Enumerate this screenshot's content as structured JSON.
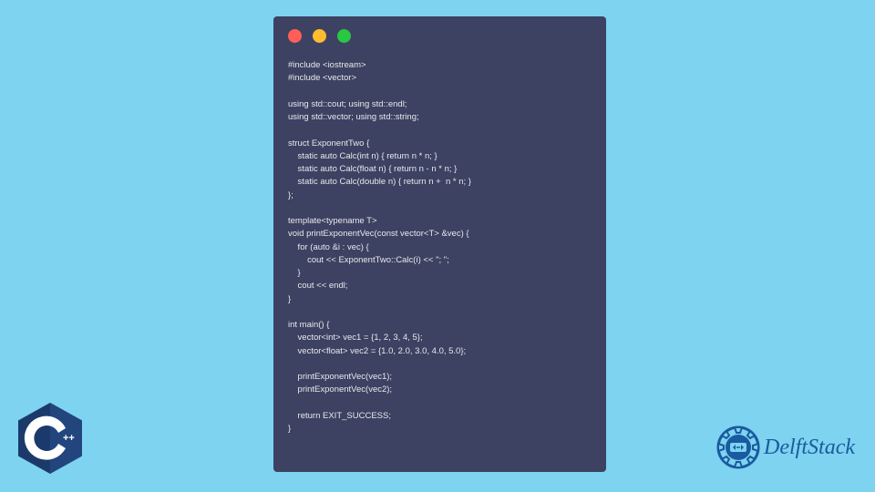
{
  "code": "#include <iostream>\n#include <vector>\n\nusing std::cout; using std::endl;\nusing std::vector; using std::string;\n\nstruct ExponentTwo {\n    static auto Calc(int n) { return n * n; }\n    static auto Calc(float n) { return n - n * n; }\n    static auto Calc(double n) { return n +  n * n; }\n};\n\ntemplate<typename T>\nvoid printExponentVec(const vector<T> &vec) {\n    for (auto &i : vec) {\n        cout << ExponentTwo::Calc(i) << \"; \";\n    }\n    cout << endl;\n}\n\nint main() {\n    vector<int> vec1 = {1, 2, 3, 4, 5};\n    vector<float> vec2 = {1.0, 2.0, 3.0, 4.0, 5.0};\n\n    printExponentVec(vec1);\n    printExponentVec(vec2);\n\n    return EXIT_SUCCESS;\n}",
  "brand": "DelftStack",
  "cpp_label": "C++"
}
